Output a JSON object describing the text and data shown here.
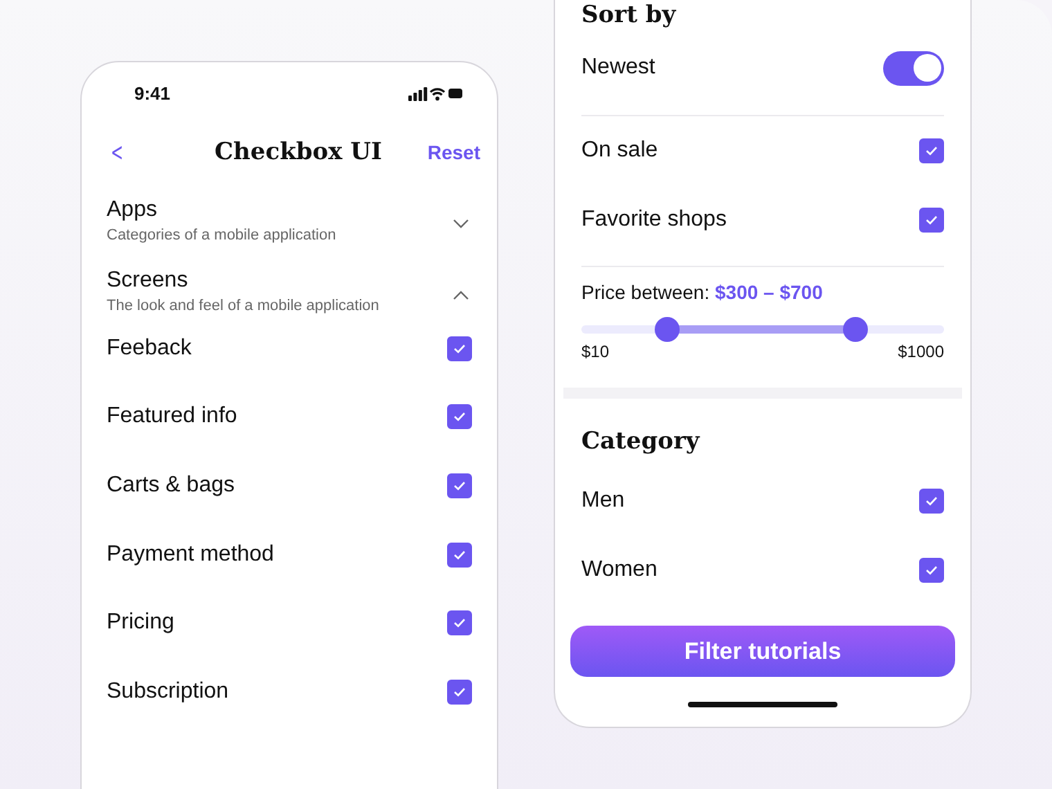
{
  "left_phone": {
    "status_bar": {
      "time": "9:41"
    },
    "header": {
      "back": "<",
      "title": "Checkbox UI",
      "action": "Reset"
    },
    "sections": [
      {
        "title": "Apps",
        "subtitle": "Categories of a mobile application",
        "expanded": false
      },
      {
        "title": "Screens",
        "subtitle": "The look and feel of a mobile application",
        "expanded": true,
        "items": [
          {
            "label": "Feeback",
            "checked": true
          },
          {
            "label": "Featured info",
            "checked": true
          },
          {
            "label": "Carts & bags",
            "checked": true
          },
          {
            "label": "Payment method",
            "checked": true
          },
          {
            "label": "Pricing",
            "checked": true
          },
          {
            "label": "Subscription",
            "checked": true
          }
        ]
      }
    ]
  },
  "right_phone": {
    "sort_by": {
      "title": "Sort by",
      "options": [
        {
          "kind": "toggle",
          "label": "Newest",
          "on": true
        },
        {
          "kind": "checkbox",
          "label": "On sale",
          "checked": true
        },
        {
          "kind": "checkbox",
          "label": "Favorite shops",
          "checked": true
        }
      ]
    },
    "price": {
      "label": "Price between: ",
      "range": "$300 – $700",
      "thumbs": [
        {
          "level": 0.235
        },
        {
          "level": 0.754
        }
      ],
      "min": "$10",
      "max": "$1000"
    },
    "category": {
      "title": "Category",
      "options": [
        {
          "label": "Men",
          "checked": true
        },
        {
          "label": "Women",
          "checked": true
        }
      ]
    },
    "button": "Filter tutorials"
  }
}
